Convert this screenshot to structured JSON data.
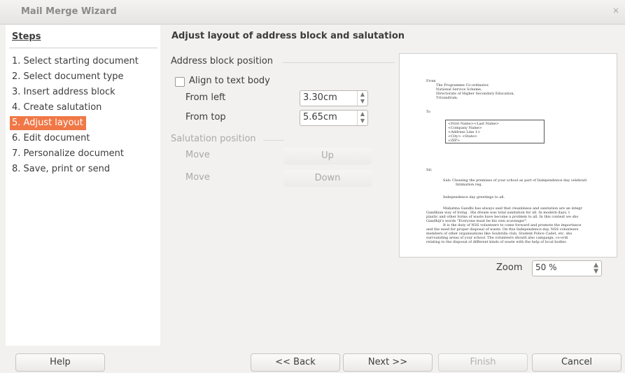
{
  "window": {
    "title": "Mail Merge Wizard",
    "close_glyph": "×"
  },
  "sidebar": {
    "title": "Steps",
    "items": [
      {
        "label": "1. Select starting document"
      },
      {
        "label": "2. Select document type"
      },
      {
        "label": "3. Insert address block"
      },
      {
        "label": "4. Create salutation"
      },
      {
        "label": "5. Adjust layout"
      },
      {
        "label": "6. Edit document"
      },
      {
        "label": "7. Personalize document"
      },
      {
        "label": "8. Save, print or send"
      }
    ],
    "active_index": 4
  },
  "main": {
    "heading": "Adjust layout of address block and salutation",
    "address_block": {
      "title": "Address block position",
      "align_label": "Align to text body",
      "align_checked": false,
      "from_left_label": "From left",
      "from_left_value": "3.30cm",
      "from_top_label": "From top",
      "from_top_value": "5.65cm"
    },
    "salutation": {
      "title": "Salutation position",
      "move_label_1": "Move",
      "up_label": "Up",
      "move_label_2": "Move",
      "down_label": "Down"
    },
    "preview": {
      "from_label": "From",
      "sender_lines": [
        "The Programme Co-ordinator,",
        "National Service Scheme,",
        "Directorate of Higher Secondary Education,",
        "Trivandrum."
      ],
      "to_label": "To",
      "address_lines": [
        "<First        Name><Last        Name>",
        "<Company                         Name>",
        "<Address         Line               1>",
        "<City>                          <State>",
        "<ZIP>"
      ],
      "sir_label": "Sir,",
      "subject_lines": [
        "Sub: Cleaning the premises of your school as part of Independence day celebrati",
        "Intimation reg."
      ],
      "greeting": "Independence day greetings to all.",
      "body_lines": [
        "Mahatma Gandhi has always said that cleanliness and sanitation are an integr",
        "Gandhian way of living . His dream was total sanitation for all. In modern days, t",
        "plastic and other forms of waste have become a problem to all. In this context we sho",
        "Gandhiji's words \"Everyone must be his own scavenger\".",
        "It is the duty of NSS volunteers to come forward and promote the importance",
        "and the need for proper disposal of waste. On this Independence day, NSS volunteers",
        "members of other organisations like Souhrida club, Student Police Cadet, etc. sho",
        "surrounding areas of your school. The volunteers should also campaign, co-ordi",
        "relating to the disposal of different kinds of waste with the help of local bodies"
      ]
    },
    "zoom": {
      "label": "Zoom",
      "value": "50 %"
    }
  },
  "buttons": {
    "help": "Help",
    "back": "<< Back",
    "next": "Next >>",
    "finish": "Finish",
    "cancel": "Cancel"
  },
  "colors": {
    "active_step": "#f07746",
    "dialog_bg": "#f2f1f0"
  }
}
